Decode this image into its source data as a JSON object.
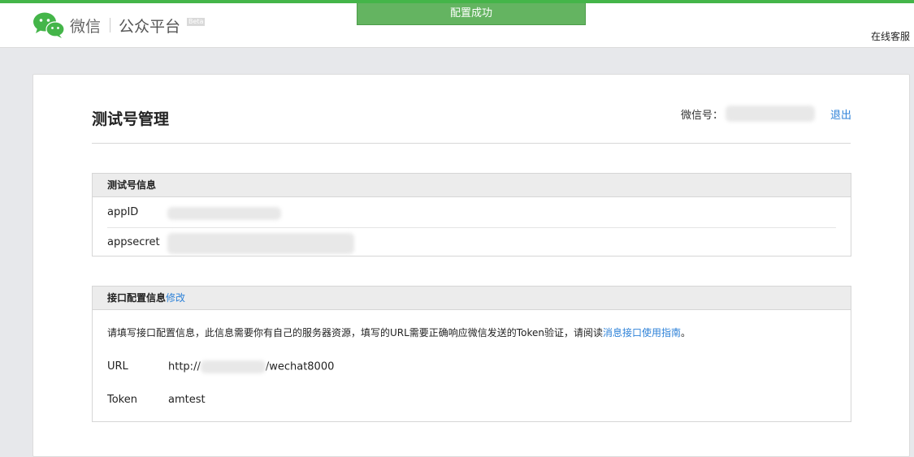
{
  "header": {
    "brand_wx": "微信",
    "brand_name": "公众平台",
    "beta": "Beta",
    "toast": "配置成功",
    "support": "在线客服"
  },
  "page": {
    "title": "测试号管理",
    "wechat_label": "微信号：",
    "logout": "退出"
  },
  "test_info": {
    "title": "测试号信息",
    "rows": [
      {
        "label": "appID",
        "value": ""
      },
      {
        "label": "appsecret",
        "value": ""
      }
    ]
  },
  "api_config": {
    "title": "接口配置信息",
    "edit": "修改",
    "description_before": "请填写接口配置信息，此信息需要你有自己的服务器资源，填写的URL需要正确响应微信发送的Token验证，请阅读",
    "description_link": "消息接口使用指南",
    "description_after": "。",
    "url_label": "URL",
    "url_prefix": "http://",
    "url_suffix": "/wechat8000",
    "token_label": "Token",
    "token_value": "amtest"
  },
  "colors": {
    "brand_green": "#44b549",
    "toast_green": "#64b461",
    "link_blue": "#2e82d8"
  }
}
